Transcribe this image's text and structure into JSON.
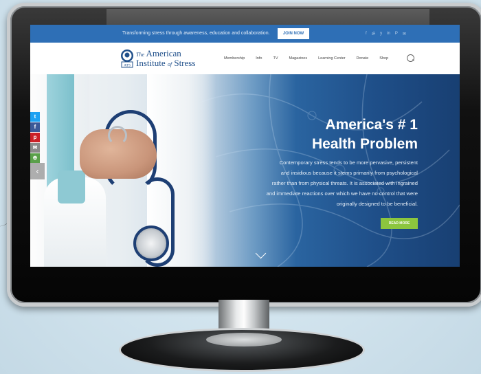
{
  "topbar": {
    "tagline": "Transforming stress through awareness, education and collaboration.",
    "join_label": "JOIN NOW",
    "social_icons": [
      "facebook-icon",
      "rss-icon",
      "twitter-icon",
      "linkedin-icon",
      "pinterest-icon",
      "email-icon"
    ],
    "social_glyphs": [
      "f",
      "ॐ",
      "y",
      "in",
      "P",
      "✉"
    ],
    "background": "#2e6fb6"
  },
  "header": {
    "logo_seal_text": "ATS",
    "logo_line1_pre": "The",
    "logo_line1_main": "American",
    "logo_line2_main": "Institute",
    "logo_line2_of": "of",
    "logo_line2_end": "Stress",
    "nav": [
      "Membership",
      "Info",
      "TV",
      "Magazines",
      "Learning Center",
      "Donate",
      "Shop"
    ]
  },
  "hero": {
    "title_line1": "America's # 1",
    "title_line2": "Health Problem",
    "body_lines": [
      "Contemporary stress tends to be more pervasive, persistent",
      "and insidious because it stems primarily from psychological",
      "rather than from physical threats. It is associated with ingrained",
      "and immediate reactions over which we have no control that were",
      "originally designed to be beneficial."
    ],
    "read_more_label": "READ MORE",
    "prev_glyph": "‹",
    "read_more_color": "#8cc63e"
  },
  "share_bar": {
    "items": [
      {
        "icon": "twitter-icon",
        "glyph": "t",
        "color": "#1da1f2"
      },
      {
        "icon": "facebook-icon",
        "glyph": "f",
        "color": "#3b5998"
      },
      {
        "icon": "pinterest-icon",
        "glyph": "p",
        "color": "#cb2027"
      },
      {
        "icon": "email-icon",
        "glyph": "✉",
        "color": "#8a8a8a"
      },
      {
        "icon": "more-icon",
        "glyph": "⊕",
        "color": "#5aa04a"
      }
    ]
  }
}
